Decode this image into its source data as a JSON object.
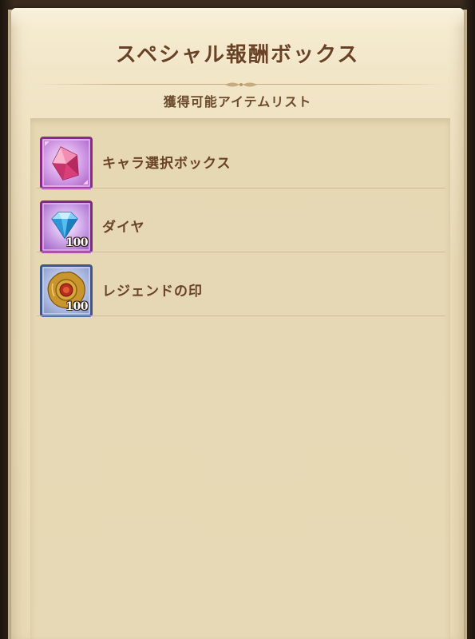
{
  "dialog": {
    "title": "スペシャル報酬ボックス",
    "subtitle": "獲得可能アイテムリスト"
  },
  "items": [
    {
      "label": "キャラ選択ボックス",
      "icon": "pink-crystal-icon",
      "quantity": "",
      "frame_color": "#a0359e"
    },
    {
      "label": "ダイヤ",
      "icon": "diamond-gem-icon",
      "quantity": "100",
      "frame_color": "#8a2e86"
    },
    {
      "label": "レジェンドの印",
      "icon": "gold-seal-icon",
      "quantity": "100",
      "frame_color": "#3f5a8c"
    }
  ],
  "colors": {
    "paper": "#eadcb8",
    "title_text": "#6a4326",
    "list_panel": "#e6d8b3"
  }
}
